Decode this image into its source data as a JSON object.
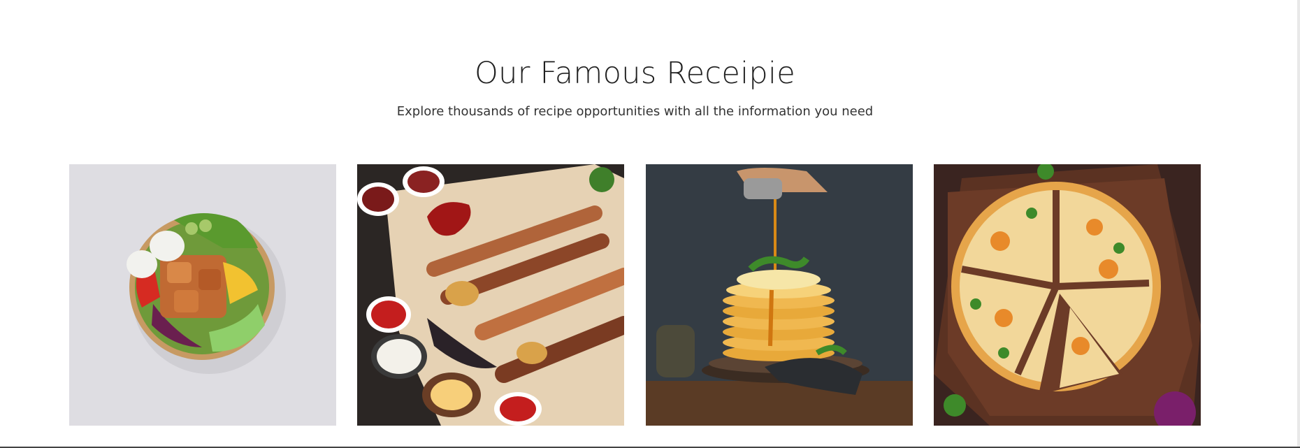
{
  "section": {
    "title": "Our Famous Receipie",
    "subtitle": "Explore thousands of recipe opportunities with all the information you need"
  },
  "cards": [
    {
      "image": "salad-bowl-photo"
    },
    {
      "image": "grilled-kebab-platter-photo"
    },
    {
      "image": "pancake-stack-syrup-photo"
    },
    {
      "image": "pizza-on-board-photo"
    }
  ]
}
